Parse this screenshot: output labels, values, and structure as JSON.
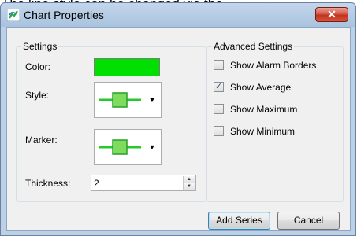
{
  "background_text": "The line style can be changed via the",
  "window": {
    "title": "Chart Properties",
    "icon": "chart-app-icon",
    "close_label": "✕"
  },
  "settings": {
    "legend": "Settings",
    "color_label": "Color:",
    "color_value": "#00e000",
    "style_label": "Style:",
    "style_icon": "line-with-square-marker-icon",
    "marker_label": "Marker:",
    "marker_icon": "line-with-square-marker-icon",
    "thickness_label": "Thickness:",
    "thickness_value": "2"
  },
  "advanced": {
    "legend": "Advanced Settings",
    "options": [
      {
        "label": "Show Alarm Borders",
        "checked": false
      },
      {
        "label": "Show Average",
        "checked": true
      },
      {
        "label": "Show Maximum",
        "checked": false
      },
      {
        "label": "Show Minimum",
        "checked": false
      }
    ]
  },
  "buttons": {
    "add_series": "Add Series",
    "cancel": "Cancel"
  },
  "glyphs": {
    "dropdown": "▼",
    "spin_up": "▲",
    "spin_down": "▼",
    "check": "✓"
  }
}
